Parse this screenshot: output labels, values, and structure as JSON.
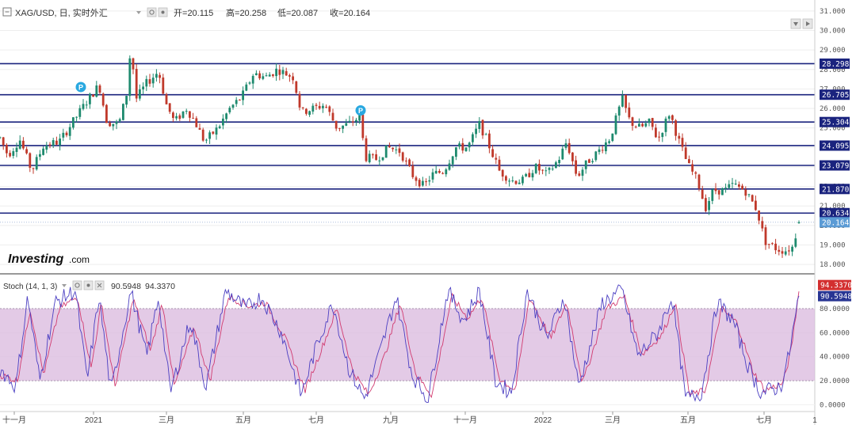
{
  "header": {
    "symbol": "XAG/USD, 日, 实时外汇",
    "ohlc": [
      {
        "label": "开=",
        "value": "20.115"
      },
      {
        "label": "高=",
        "value": "20.258"
      },
      {
        "label": "低=",
        "value": "20.087"
      },
      {
        "label": "收=",
        "value": "20.164"
      }
    ]
  },
  "logo": {
    "main": "Investing",
    "sub": ".com"
  },
  "markers": {
    "p_label": "P"
  },
  "colors": {
    "up": "#1e8a6e",
    "down": "#c0392b",
    "level_line": "#1a237e",
    "level_label_bg": "#1a237e",
    "price_label_bg": "#5b9bd5",
    "stoch_k": "#4b3fc2",
    "stoch_d": "#d13b70",
    "stoch_band": "#d9b8de",
    "stoch_d_label_bg": "#d32f2f",
    "stoch_k_label_bg": "#283593"
  },
  "chart_data": [
    {
      "type": "candlestick",
      "title": "XAG/USD, 日, 实时外汇",
      "y_axis": {
        "ticks": [
          "18.000",
          "19.000",
          "20.000",
          "21.000",
          "22.000",
          "23.000",
          "24.000",
          "25.000",
          "26.000",
          "27.000",
          "28.000",
          "29.000",
          "30.000",
          "31.000"
        ],
        "range": [
          17.6,
          31.4
        ]
      },
      "x_axis": {
        "ticks": [
          "十一月",
          "2021",
          "三月",
          "五月",
          "七月",
          "九月",
          "十一月",
          "2022",
          "三月",
          "五月",
          "七月"
        ]
      },
      "last": {
        "open": 20.115,
        "high": 20.258,
        "low": 20.087,
        "close": 20.164
      },
      "levels": [
        28.298,
        26.705,
        25.304,
        24.095,
        23.079,
        21.87,
        20.634
      ],
      "current_price": 20.164,
      "close_path": [
        {
          "t": 0,
          "v": 24.5
        },
        {
          "t": 10,
          "v": 23.6
        },
        {
          "t": 25,
          "v": 24.4
        },
        {
          "t": 40,
          "v": 22.8
        },
        {
          "t": 55,
          "v": 24.1
        },
        {
          "t": 75,
          "v": 24.3
        },
        {
          "t": 95,
          "v": 25.5
        },
        {
          "t": 110,
          "v": 26.4
        },
        {
          "t": 125,
          "v": 27.2
        },
        {
          "t": 135,
          "v": 25.3
        },
        {
          "t": 150,
          "v": 25.2
        },
        {
          "t": 160,
          "v": 26.8
        },
        {
          "t": 165,
          "v": 29.2
        },
        {
          "t": 172,
          "v": 26.5
        },
        {
          "t": 185,
          "v": 27.3
        },
        {
          "t": 200,
          "v": 27.9
        },
        {
          "t": 210,
          "v": 26.2
        },
        {
          "t": 220,
          "v": 25.3
        },
        {
          "t": 235,
          "v": 26.0
        },
        {
          "t": 245,
          "v": 25.4
        },
        {
          "t": 258,
          "v": 24.3
        },
        {
          "t": 275,
          "v": 25.0
        },
        {
          "t": 290,
          "v": 26.0
        },
        {
          "t": 305,
          "v": 26.6
        },
        {
          "t": 320,
          "v": 27.8
        },
        {
          "t": 335,
          "v": 27.6
        },
        {
          "t": 350,
          "v": 28.0
        },
        {
          "t": 370,
          "v": 27.6
        },
        {
          "t": 380,
          "v": 25.8
        },
        {
          "t": 395,
          "v": 26.0
        },
        {
          "t": 410,
          "v": 26.2
        },
        {
          "t": 425,
          "v": 25.0
        },
        {
          "t": 440,
          "v": 25.2
        },
        {
          "t": 455,
          "v": 25.6
        },
        {
          "t": 460,
          "v": 23.5
        },
        {
          "t": 475,
          "v": 23.4
        },
        {
          "t": 490,
          "v": 24.0
        },
        {
          "t": 505,
          "v": 23.8
        },
        {
          "t": 520,
          "v": 22.6
        },
        {
          "t": 535,
          "v": 22.0
        },
        {
          "t": 545,
          "v": 22.6
        },
        {
          "t": 560,
          "v": 22.8
        },
        {
          "t": 575,
          "v": 24.0
        },
        {
          "t": 590,
          "v": 24.0
        },
        {
          "t": 605,
          "v": 25.2
        },
        {
          "t": 615,
          "v": 24.3
        },
        {
          "t": 630,
          "v": 22.8
        },
        {
          "t": 645,
          "v": 22.3
        },
        {
          "t": 660,
          "v": 22.3
        },
        {
          "t": 675,
          "v": 23.0
        },
        {
          "t": 690,
          "v": 22.6
        },
        {
          "t": 705,
          "v": 23.4
        },
        {
          "t": 715,
          "v": 24.3
        },
        {
          "t": 728,
          "v": 22.5
        },
        {
          "t": 742,
          "v": 23.3
        },
        {
          "t": 755,
          "v": 23.8
        },
        {
          "t": 770,
          "v": 24.5
        },
        {
          "t": 785,
          "v": 26.5
        },
        {
          "t": 795,
          "v": 25.3
        },
        {
          "t": 808,
          "v": 25.0
        },
        {
          "t": 820,
          "v": 25.3
        },
        {
          "t": 830,
          "v": 24.4
        },
        {
          "t": 845,
          "v": 25.8
        },
        {
          "t": 855,
          "v": 24.5
        },
        {
          "t": 868,
          "v": 23.1
        },
        {
          "t": 880,
          "v": 22.3
        },
        {
          "t": 890,
          "v": 20.9
        },
        {
          "t": 900,
          "v": 21.8
        },
        {
          "t": 915,
          "v": 21.8
        },
        {
          "t": 925,
          "v": 22.1
        },
        {
          "t": 940,
          "v": 21.8
        },
        {
          "t": 955,
          "v": 20.8
        },
        {
          "t": 965,
          "v": 19.2
        },
        {
          "t": 980,
          "v": 18.8
        },
        {
          "t": 990,
          "v": 18.7
        },
        {
          "t": 1000,
          "v": 18.9
        },
        {
          "t": 1008,
          "v": 20.164
        }
      ]
    },
    {
      "type": "line",
      "title": "Stoch (14, 1, 3)",
      "series": [
        {
          "name": "%K",
          "value_label": "90.5948"
        },
        {
          "name": "%D",
          "value_label": "94.3370"
        }
      ],
      "y_axis": {
        "ticks": [
          "0.0000",
          "20.0000",
          "40.0000",
          "60.0000",
          "80.0000"
        ],
        "range": [
          -5,
          105
        ]
      },
      "bands": [
        20,
        80
      ],
      "last": {
        "k": 90.5948,
        "d": 94.337
      },
      "k_path": [
        {
          "t": 0,
          "v": 30
        },
        {
          "t": 20,
          "v": 15
        },
        {
          "t": 35,
          "v": 90
        },
        {
          "t": 50,
          "v": 20
        },
        {
          "t": 70,
          "v": 85
        },
        {
          "t": 95,
          "v": 95
        },
        {
          "t": 110,
          "v": 20
        },
        {
          "t": 125,
          "v": 90
        },
        {
          "t": 140,
          "v": 10
        },
        {
          "t": 165,
          "v": 95
        },
        {
          "t": 185,
          "v": 40
        },
        {
          "t": 200,
          "v": 90
        },
        {
          "t": 215,
          "v": 10
        },
        {
          "t": 240,
          "v": 70
        },
        {
          "t": 260,
          "v": 15
        },
        {
          "t": 285,
          "v": 95
        },
        {
          "t": 310,
          "v": 80
        },
        {
          "t": 330,
          "v": 90
        },
        {
          "t": 355,
          "v": 60
        },
        {
          "t": 380,
          "v": 8
        },
        {
          "t": 400,
          "v": 50
        },
        {
          "t": 420,
          "v": 85
        },
        {
          "t": 440,
          "v": 30
        },
        {
          "t": 460,
          "v": 5
        },
        {
          "t": 480,
          "v": 45
        },
        {
          "t": 500,
          "v": 90
        },
        {
          "t": 520,
          "v": 25
        },
        {
          "t": 540,
          "v": 5
        },
        {
          "t": 565,
          "v": 95
        },
        {
          "t": 585,
          "v": 70
        },
        {
          "t": 605,
          "v": 95
        },
        {
          "t": 625,
          "v": 20
        },
        {
          "t": 645,
          "v": 10
        },
        {
          "t": 665,
          "v": 95
        },
        {
          "t": 690,
          "v": 55
        },
        {
          "t": 712,
          "v": 90
        },
        {
          "t": 730,
          "v": 15
        },
        {
          "t": 760,
          "v": 85
        },
        {
          "t": 785,
          "v": 95
        },
        {
          "t": 805,
          "v": 40
        },
        {
          "t": 830,
          "v": 60
        },
        {
          "t": 848,
          "v": 90
        },
        {
          "t": 865,
          "v": 5
        },
        {
          "t": 885,
          "v": 10
        },
        {
          "t": 905,
          "v": 85
        },
        {
          "t": 925,
          "v": 70
        },
        {
          "t": 945,
          "v": 30
        },
        {
          "t": 960,
          "v": 10
        },
        {
          "t": 985,
          "v": 15
        },
        {
          "t": 995,
          "v": 40
        },
        {
          "t": 1008,
          "v": 90.5948
        }
      ],
      "d_path": [
        {
          "t": 0,
          "v": 25
        },
        {
          "t": 22,
          "v": 20
        },
        {
          "t": 38,
          "v": 80
        },
        {
          "t": 55,
          "v": 25
        },
        {
          "t": 75,
          "v": 80
        },
        {
          "t": 98,
          "v": 90
        },
        {
          "t": 115,
          "v": 30
        },
        {
          "t": 128,
          "v": 85
        },
        {
          "t": 145,
          "v": 15
        },
        {
          "t": 168,
          "v": 88
        },
        {
          "t": 190,
          "v": 45
        },
        {
          "t": 205,
          "v": 85
        },
        {
          "t": 220,
          "v": 15
        },
        {
          "t": 245,
          "v": 65
        },
        {
          "t": 265,
          "v": 20
        },
        {
          "t": 288,
          "v": 90
        },
        {
          "t": 315,
          "v": 82
        },
        {
          "t": 335,
          "v": 85
        },
        {
          "t": 360,
          "v": 55
        },
        {
          "t": 385,
          "v": 12
        },
        {
          "t": 405,
          "v": 45
        },
        {
          "t": 425,
          "v": 80
        },
        {
          "t": 445,
          "v": 28
        },
        {
          "t": 465,
          "v": 8
        },
        {
          "t": 485,
          "v": 40
        },
        {
          "t": 505,
          "v": 85
        },
        {
          "t": 525,
          "v": 25
        },
        {
          "t": 545,
          "v": 8
        },
        {
          "t": 570,
          "v": 90
        },
        {
          "t": 590,
          "v": 72
        },
        {
          "t": 608,
          "v": 90
        },
        {
          "t": 630,
          "v": 22
        },
        {
          "t": 650,
          "v": 12
        },
        {
          "t": 668,
          "v": 90
        },
        {
          "t": 695,
          "v": 55
        },
        {
          "t": 715,
          "v": 85
        },
        {
          "t": 735,
          "v": 18
        },
        {
          "t": 765,
          "v": 80
        },
        {
          "t": 788,
          "v": 90
        },
        {
          "t": 810,
          "v": 42
        },
        {
          "t": 835,
          "v": 58
        },
        {
          "t": 852,
          "v": 85
        },
        {
          "t": 870,
          "v": 8
        },
        {
          "t": 890,
          "v": 12
        },
        {
          "t": 910,
          "v": 80
        },
        {
          "t": 930,
          "v": 68
        },
        {
          "t": 950,
          "v": 28
        },
        {
          "t": 965,
          "v": 12
        },
        {
          "t": 988,
          "v": 18
        },
        {
          "t": 998,
          "v": 45
        },
        {
          "t": 1008,
          "v": 94.337
        }
      ]
    }
  ]
}
